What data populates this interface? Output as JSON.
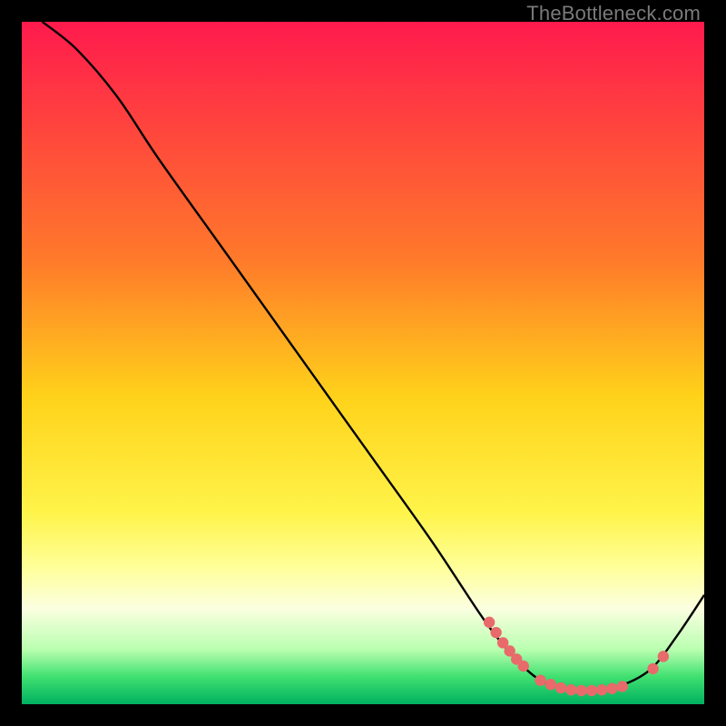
{
  "watermark": "TheBottleneck.com",
  "chart_data": {
    "type": "line",
    "title": "",
    "xlabel": "",
    "ylabel": "",
    "xlim": [
      0,
      100
    ],
    "ylim": [
      0,
      100
    ],
    "gradient_stops": [
      {
        "offset": 0,
        "color": "#ff1a4d"
      },
      {
        "offset": 35,
        "color": "#ff7a2a"
      },
      {
        "offset": 55,
        "color": "#ffd21a"
      },
      {
        "offset": 72,
        "color": "#fff44a"
      },
      {
        "offset": 80,
        "color": "#ffff9a"
      },
      {
        "offset": 86,
        "color": "#fbffe0"
      },
      {
        "offset": 92,
        "color": "#b9ffb0"
      },
      {
        "offset": 96,
        "color": "#3fe070"
      },
      {
        "offset": 100,
        "color": "#00b060"
      }
    ],
    "series": [
      {
        "name": "curve",
        "points": [
          {
            "x": 3,
            "y": 100
          },
          {
            "x": 8,
            "y": 96
          },
          {
            "x": 14,
            "y": 89
          },
          {
            "x": 20,
            "y": 80
          },
          {
            "x": 30,
            "y": 66
          },
          {
            "x": 40,
            "y": 52
          },
          {
            "x": 50,
            "y": 38
          },
          {
            "x": 60,
            "y": 24
          },
          {
            "x": 68,
            "y": 12
          },
          {
            "x": 73,
            "y": 6
          },
          {
            "x": 77,
            "y": 3
          },
          {
            "x": 82,
            "y": 2
          },
          {
            "x": 87,
            "y": 2.5
          },
          {
            "x": 92,
            "y": 5
          },
          {
            "x": 96,
            "y": 10
          },
          {
            "x": 100,
            "y": 16
          }
        ]
      }
    ],
    "markers": [
      {
        "x": 68.5,
        "y": 12
      },
      {
        "x": 69.5,
        "y": 10.5
      },
      {
        "x": 70.5,
        "y": 9
      },
      {
        "x": 71.5,
        "y": 7.8
      },
      {
        "x": 72.5,
        "y": 6.6
      },
      {
        "x": 73.5,
        "y": 5.6
      },
      {
        "x": 76,
        "y": 3.5
      },
      {
        "x": 77.5,
        "y": 2.9
      },
      {
        "x": 79,
        "y": 2.4
      },
      {
        "x": 80.5,
        "y": 2.1
      },
      {
        "x": 82,
        "y": 2.0
      },
      {
        "x": 83.5,
        "y": 2.0
      },
      {
        "x": 85,
        "y": 2.1
      },
      {
        "x": 86.5,
        "y": 2.3
      },
      {
        "x": 88,
        "y": 2.6
      },
      {
        "x": 92.5,
        "y": 5.2
      },
      {
        "x": 94,
        "y": 7.0
      }
    ],
    "marker_color": "#e86a6a",
    "curve_color": "#000000"
  }
}
